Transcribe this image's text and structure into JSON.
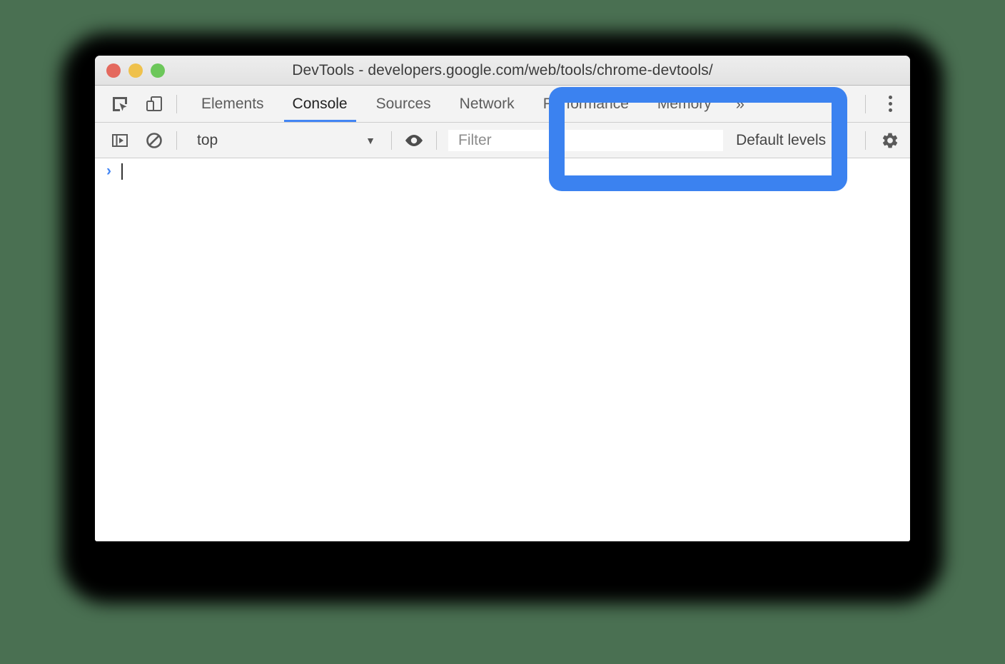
{
  "window": {
    "title": "DevTools - developers.google.com/web/tools/chrome-devtools/",
    "traffic_lights": [
      "close",
      "minimize",
      "maximize"
    ]
  },
  "tabbar": {
    "inspect_icon": "inspect-element-icon",
    "device_icon": "device-toolbar-icon",
    "tabs": [
      {
        "label": "Elements",
        "active": false
      },
      {
        "label": "Console",
        "active": true
      },
      {
        "label": "Sources",
        "active": false
      },
      {
        "label": "Network",
        "active": false
      },
      {
        "label": "Performance",
        "active": false
      },
      {
        "label": "Memory",
        "active": false
      }
    ],
    "overflow_label": "»",
    "more_menu_icon": "three-dot-menu-icon"
  },
  "filterbar": {
    "sidebar_toggle_icon": "console-sidebar-toggle-icon",
    "clear_console_icon": "clear-console-icon",
    "context_value": "top",
    "context_caret": "▼",
    "live_expression_icon": "eye-icon",
    "filter_placeholder": "Filter",
    "filter_value": "",
    "levels_label": "Default levels",
    "levels_caret": "▼",
    "settings_icon": "gear-icon"
  },
  "console": {
    "prompt_arrow": "›",
    "prompt_value": ""
  },
  "annotation": {
    "type": "highlight-box",
    "color": "#3b82f0",
    "target": "log-level-filter-area"
  },
  "colors": {
    "page_background": "#4a7052",
    "accent": "#4285f4",
    "annotation_blue": "#3b82f0",
    "chrome_gray": "#f3f3f3",
    "titlebar_gray": "#e6e6e6",
    "traffic_red": "#e4695e",
    "traffic_yellow": "#efc14c",
    "traffic_green": "#6cc75a"
  }
}
